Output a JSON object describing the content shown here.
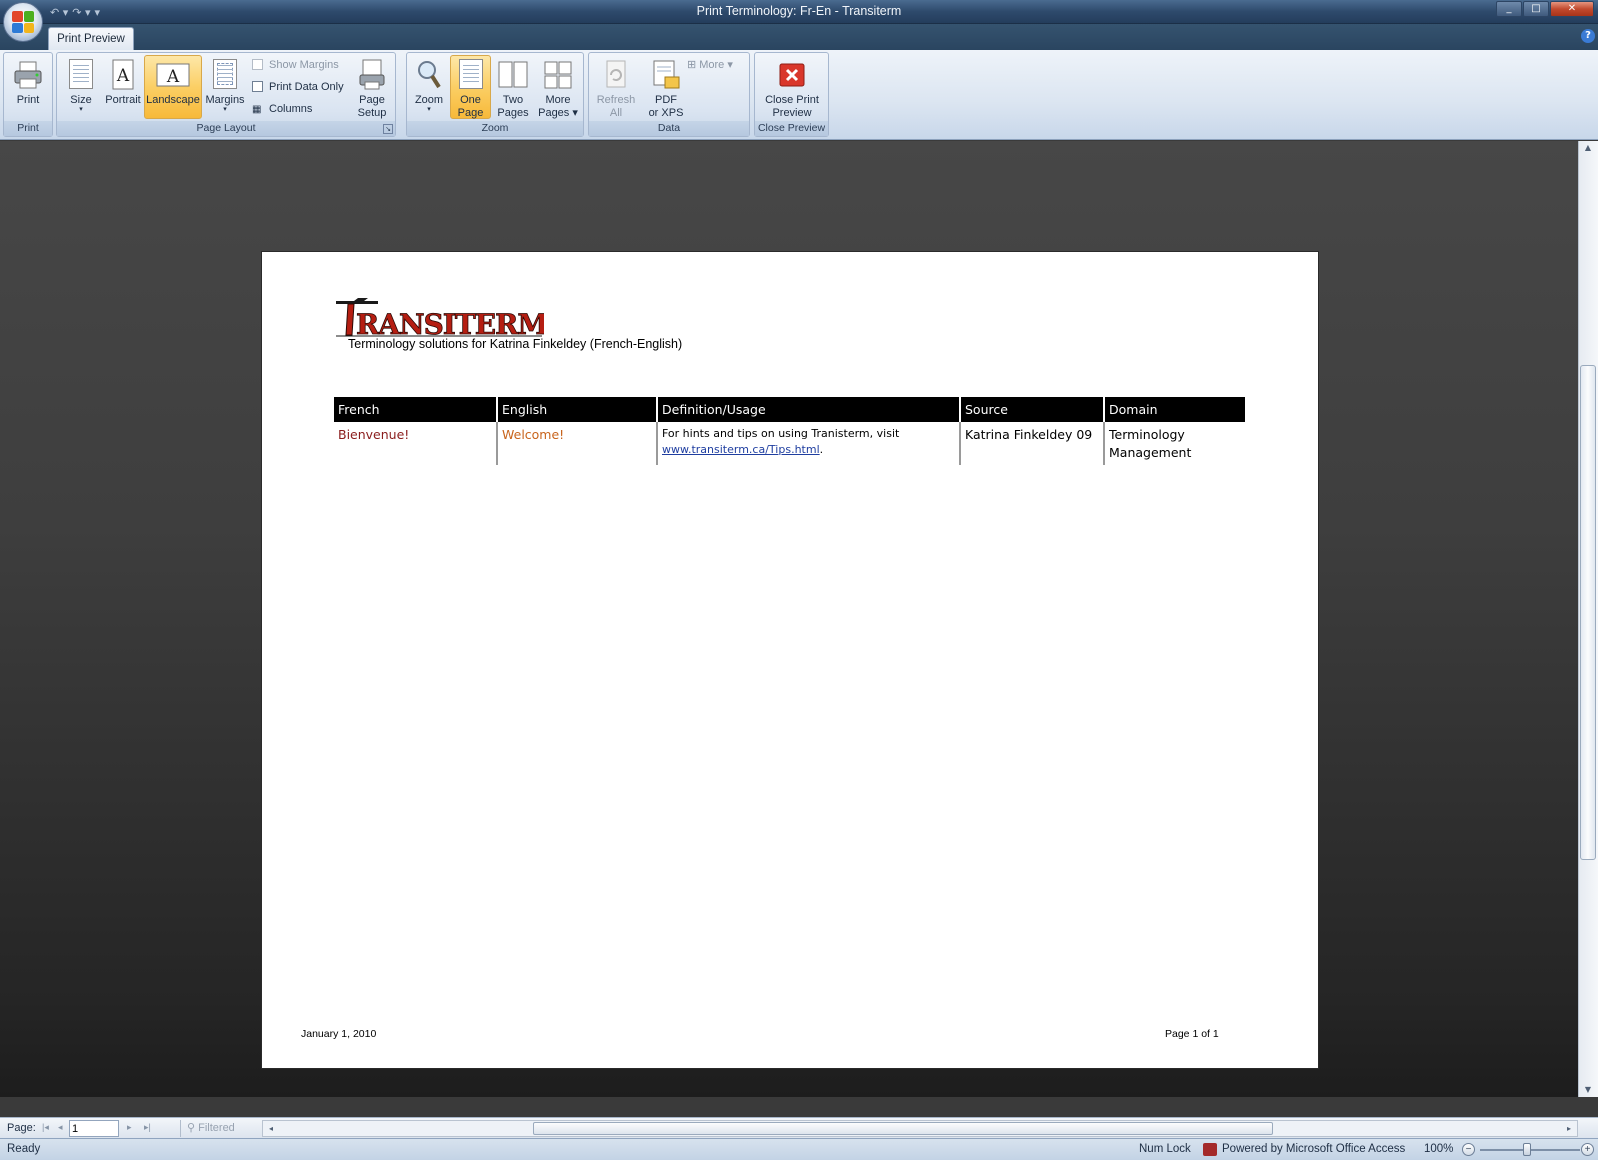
{
  "window": {
    "title": "Print Terminology: Fr-En  -  Transiterm",
    "controls": {
      "minimize": "_",
      "maximize": "□",
      "close": "✕"
    }
  },
  "quick_access": {
    "undo": "↶ ▾",
    "redo": "↷ ▾",
    "customize": "▾"
  },
  "ribbon": {
    "tab": "Print Preview",
    "help_label": "?",
    "groups": {
      "print": {
        "label": "Print",
        "print_button": "Print"
      },
      "page_layout": {
        "label": "Page Layout",
        "size": "Size",
        "portrait": "Portrait",
        "landscape": "Landscape",
        "margins": "Margins",
        "show_margins": "Show Margins",
        "print_data_only": "Print Data Only",
        "columns": "Columns",
        "page_setup_line1": "Page",
        "page_setup_line2": "Setup"
      },
      "zoom": {
        "label": "Zoom",
        "zoom": "Zoom",
        "one_page_line1": "One",
        "one_page_line2": "Page",
        "two_pages_line1": "Two",
        "two_pages_line2": "Pages",
        "more_pages_line1": "More",
        "more_pages_line2": "Pages"
      },
      "data": {
        "label": "Data",
        "refresh_line1": "Refresh",
        "refresh_line2": "All",
        "pdf_line1": "PDF",
        "pdf_line2": "or XPS",
        "more": "More"
      },
      "close_preview": {
        "label": "Close Preview",
        "close_line1": "Close Print",
        "close_line2": "Preview"
      }
    }
  },
  "report": {
    "logo_text": "TRANSITERM",
    "subtitle": "Terminology solutions for Katrina Finkeldey (French-English)",
    "columns": [
      "French",
      "English",
      "Definition/Usage",
      "Source",
      "Domain"
    ],
    "rows": [
      {
        "french": "Bienvenue!",
        "english": "Welcome!",
        "definition_text": "For hints and tips on using Tranisterm, visit",
        "definition_link": "www.transiterm.ca/Tips.html",
        "definition_after": ".",
        "source": "Katrina Finkeldey 09",
        "domain": "Terminology Management"
      }
    ],
    "footer_date": "January 1, 2010",
    "footer_page": "Page 1 of 1"
  },
  "navigation": {
    "page_label": "Page:",
    "current_page": "1",
    "first": "|◂",
    "prev": "◂",
    "next": "▸",
    "last": "▸|",
    "filtered": "Filtered"
  },
  "statusbar": {
    "ready": "Ready",
    "num_lock": "Num Lock",
    "powered_by": "Powered by Microsoft Office Access",
    "zoom": "100%",
    "zoom_out": "−",
    "zoom_in": "+"
  },
  "colors": {
    "active_button": "#fbcf65",
    "french_term": "#8a1c1c",
    "english_term": "#c8641c",
    "link": "#1f3ea0",
    "logo_red": "#b51e12"
  }
}
